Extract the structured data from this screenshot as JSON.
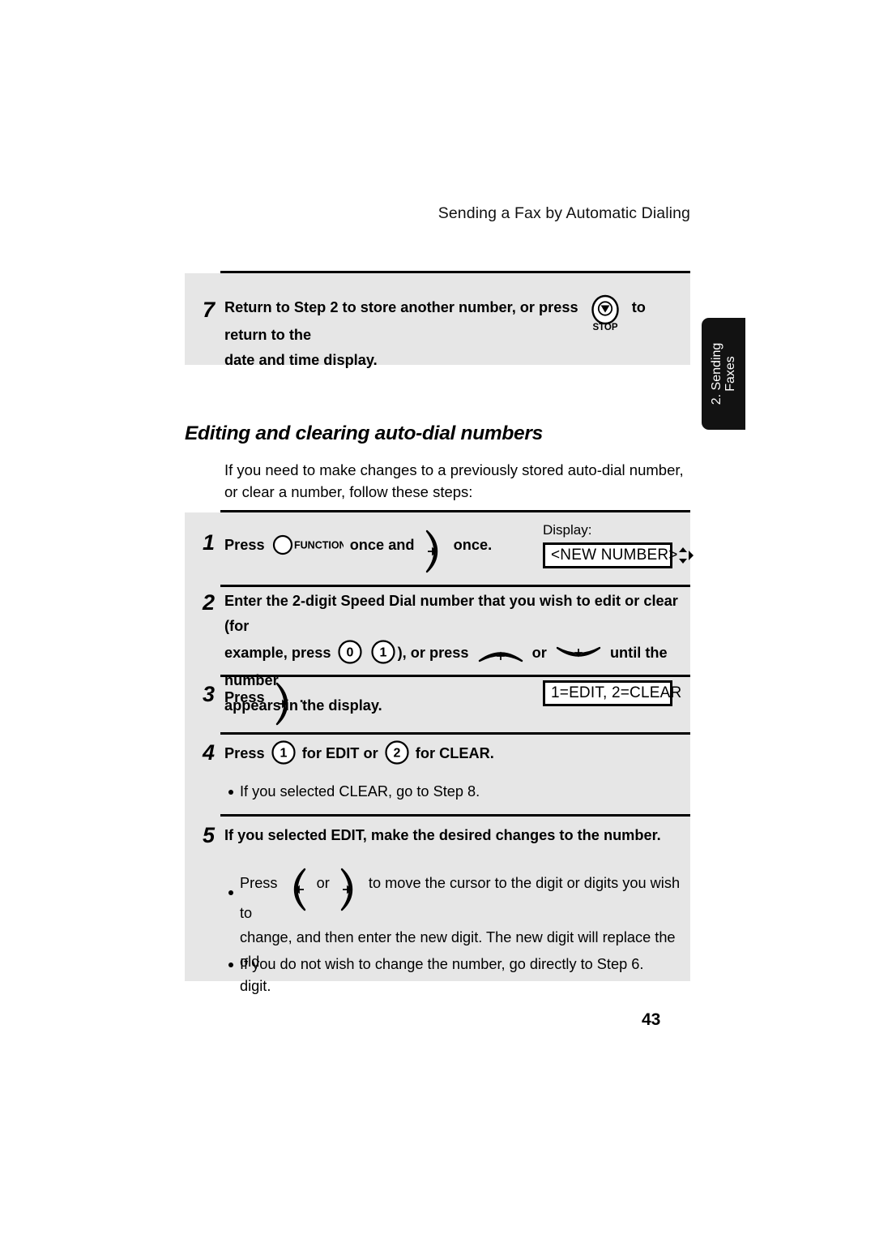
{
  "header": {
    "running_title": "Sending a Fax by Automatic Dialing"
  },
  "side_tab": {
    "line1": "2. Sending",
    "line2": "Faxes"
  },
  "top_step": {
    "number": "7",
    "text_before_icon": "Return to Step 2 to store another number, or press",
    "icon": "stop-key",
    "icon_label": "STOP",
    "text_after_icon": "to return to the",
    "line2": "date and time display."
  },
  "section": {
    "heading": "Editing and clearing auto-dial numbers",
    "intro_line1": "If you need to make changes to a previously stored auto-dial number, or clear",
    "intro_line2": "a number, follow these steps:"
  },
  "steps": [
    {
      "number": "1",
      "seg1": "Press",
      "function_key_label": "FUNCTION",
      "seg2": "once and",
      "seg3": "once.",
      "display_label": "Display:",
      "display_value": "<NEW NUMBER>"
    },
    {
      "number": "2",
      "line1": "Enter the 2-digit Speed Dial number that you wish to edit or clear (for",
      "line2_a": "example, press",
      "digit_a": "0",
      "digit_b": "1",
      "line2_b": "), or press",
      "line2_c": "or",
      "line2_d": "until the number",
      "line3": "appears in the display."
    },
    {
      "number": "3",
      "seg1": "Press",
      "seg2": ".",
      "display_value": "1=EDIT, 2=CLEAR"
    },
    {
      "number": "4",
      "seg1": "Press",
      "digit_a": "1",
      "seg2": "for EDIT or",
      "digit_b": "2",
      "seg3": "for CLEAR.",
      "bullet1": "If you selected CLEAR, go to Step 8."
    },
    {
      "number": "5",
      "line1": "If you selected EDIT, make the desired changes to the number.",
      "bullet1_a": "Press",
      "bullet1_b": "or",
      "bullet1_c": "to move the cursor to the digit or digits you wish to",
      "bullet1_line2": "change, and then enter the new digit. The new digit will replace the old",
      "bullet1_line3": "digit.",
      "bullet2": "If you do not wish to change the number, go directly to Step 6."
    }
  ],
  "footer": {
    "page_number": "43"
  },
  "colors": {
    "panel_background": "#e6e6e6",
    "rule": "#000000",
    "tab_background": "#121212",
    "page_background": "#ffffff"
  }
}
